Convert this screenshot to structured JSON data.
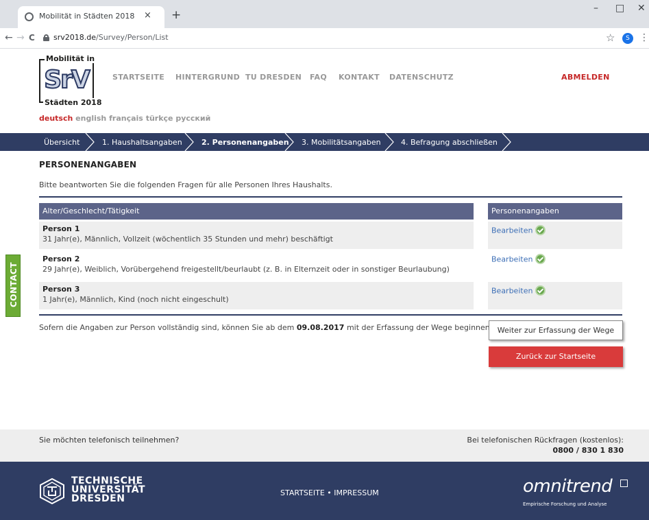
{
  "browser": {
    "tab_title": "Mobilität in Städten 2018",
    "tab_close": "×",
    "new_tab": "+",
    "window_minimize": "–",
    "window_maximize": "□",
    "window_close": "✕",
    "back": "←",
    "forward": "→",
    "reload": "C",
    "url_host": "srv2018.de",
    "url_path": "/Survey/Person/List",
    "star": "☆",
    "profile_initial": "S",
    "menu": "⋮"
  },
  "logo": {
    "top": "Mobilität in",
    "mark": "SrV",
    "bottom": "Städten 2018"
  },
  "nav": {
    "items": [
      "STARTSEITE",
      "HINTERGRUND",
      "TU DRESDEN",
      "FAQ",
      "KONTAKT",
      "DATENSCHUTZ"
    ],
    "logout": "ABMELDEN"
  },
  "languages": {
    "active": "deutsch",
    "others": [
      "english",
      "français",
      "türkçe",
      "русский"
    ]
  },
  "steps": [
    {
      "label": "Übersicht"
    },
    {
      "label": "1. Haushaltsangaben"
    },
    {
      "label": "2. Personenangaben",
      "current": true
    },
    {
      "label": "3. Mobilitätsangaben"
    },
    {
      "label": "4. Befragung abschließen"
    }
  ],
  "page": {
    "title": "PERSONENANGABEN",
    "intro": "Bitte beantworten Sie die folgenden Fragen für alle Personen Ihres Haushalts."
  },
  "table": {
    "col_left": "Alter/Geschlecht/Tätigkeit",
    "col_right": "Personenangaben",
    "rows": [
      {
        "name": "Person 1",
        "desc": "31 Jahr(e), Männlich, Vollzeit (wöchentlich 35 Stunden und mehr) beschäftigt",
        "action": "Bearbeiten",
        "status": "complete"
      },
      {
        "name": "Person 2",
        "desc": "29 Jahr(e), Weiblich, Vorübergehend freigestellt/beurlaubt (z. B. in Elternzeit oder in sonstiger Beurlaubung)",
        "action": "Bearbeiten",
        "status": "complete"
      },
      {
        "name": "Person 3",
        "desc": "1 Jahr(e), Männlich, Kind (noch nicht eingeschult)",
        "action": "Bearbeiten",
        "status": "complete"
      }
    ]
  },
  "note": {
    "before": "Sofern die Angaben zur Person vollständig sind, können Sie ab dem ",
    "date": "09.08.2017",
    "after": " mit der Erfassung der Wege beginnen."
  },
  "buttons": {
    "continue": "Weiter zur Erfassung der Wege",
    "back": "Zurück zur Startseite"
  },
  "contact_tab": "CONTACT",
  "phone": {
    "question": "Sie möchten telefonisch teilnehmen?",
    "hotline_label": "Bei telefonischen Rückfragen (kostenlos):",
    "hotline_number": "0800 / 830 1 830"
  },
  "footer": {
    "tu_lines": [
      "TECHNISCHE",
      "UNIVERSITÄT",
      "DRESDEN"
    ],
    "links": [
      "STARTSEITE",
      "IMPRESSUM"
    ],
    "link_separator": "•",
    "partner_name": "omnitrend",
    "partner_tagline": "Empirische Forschung und Analyse"
  },
  "colors": {
    "nav_bar": "#2f3d63",
    "table_header": "#5c6489",
    "accent_red": "#c62828",
    "button_red": "#d93b3b",
    "contact_green": "#6cab35",
    "link_blue": "#3d6fb6"
  }
}
